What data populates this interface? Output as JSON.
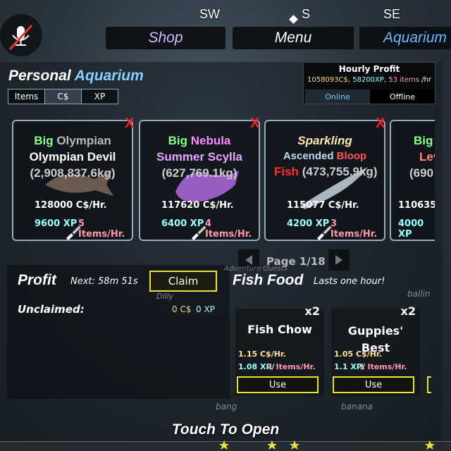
{
  "compass": {
    "sw": "SW",
    "s": "S",
    "se": "SE"
  },
  "nav": {
    "shop": "Shop",
    "menu": "Menu",
    "aquarium": "Aquarium"
  },
  "title": {
    "personal": "Personal",
    "aquarium": "Aquarium"
  },
  "tabs": [
    "Items",
    "C$",
    "XP"
  ],
  "hourly": {
    "title": "Hourly Profit",
    "cs": "1058093C$,",
    "xp": " 58200XP,",
    "items": " 53 items",
    "unit": " /hr",
    "online": "Online",
    "offline": "Offline"
  },
  "cards": [
    {
      "l1a": "Big",
      "l1b": " Olympian",
      "l2": "Olympian Devil",
      "l3": "(2,908,837.6kg)",
      "profit": "128000 C$/Hr.",
      "xp": "9600 XP",
      "items": "5 Items/Hr."
    },
    {
      "l1a": "Big",
      "l1b": " Nebula",
      "l2": "Summer Scylla",
      "l3": "(627,769.1kg)",
      "profit": "117620 C$/Hr.",
      "xp": "6400 XP",
      "items": "4 Items/Hr."
    },
    {
      "l1a": "Sparkling",
      "l1b": "",
      "l2a": "Ascended",
      "l2b": " Bloop",
      "l2c": "Fish",
      "l3": "(473,755.9kg)",
      "profit": "115077 C$/Hr.",
      "xp": "4200 XP",
      "items": "3 Items/Hr."
    },
    {
      "l1a": "Big",
      "l1b": "",
      "l2": "Lev",
      "l3": "(690",
      "profit": "110635",
      "xp": "4000 XP",
      "items": ""
    }
  ],
  "page": "Page 1/18",
  "profit": {
    "title": "Profit",
    "next": "Next: 58m 51s",
    "claim": "Claim",
    "unclaimed": "Unclaimed:",
    "cs": "0 C$",
    "xp": "0 XP"
  },
  "food": {
    "title": "Fish Food",
    "note": "Lasts one hour!",
    "items": [
      {
        "name": "Fish Chow",
        "qty": "x2",
        "profit": "1.15 C$/Hr.",
        "xp": "1.08 XP/",
        "items": "1 Items/Hr.",
        "use": "Use"
      },
      {
        "name": "Guppies' Best",
        "qty": "x2",
        "profit": "1.05 C$/Hr.",
        "xp": "1.1 XP/",
        "items": "1 Items/Hr.",
        "use": "Use"
      }
    ]
  },
  "touch": "Touch To Open",
  "bg_labels": {
    "dilly": "Dilly",
    "ballin": "ballin",
    "bang": "bang",
    "banana": "banana",
    "quests": "Adventure Quests"
  },
  "colors": {
    "claim_border": "#e7e33a",
    "remove_x": "#e22",
    "aquarium_title": "#8ad0ff",
    "shop": "#d7b8ff"
  }
}
